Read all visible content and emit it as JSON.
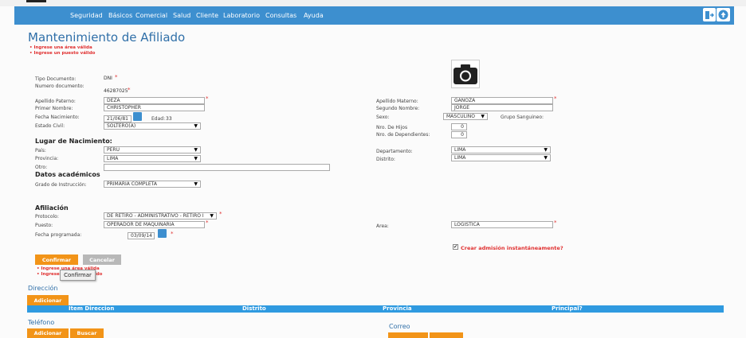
{
  "nav": {
    "menu": [
      "Seguridad",
      "Básicos",
      "Comercial",
      "Salud",
      "Cliente",
      "Laboratorio",
      "Consultas",
      "Ayuda"
    ]
  },
  "page": {
    "title": "Mantenimiento de Afiliado",
    "errors": [
      "Ingrese una área válida",
      "Ingrese un puesto válido"
    ]
  },
  "form": {
    "tipo_doc_label": "Tipo Documento:",
    "tipo_doc_value": "DNI",
    "num_doc_label": "Numero documento:",
    "num_doc_value": "46287025",
    "ap_paterno_label": "Apellido Paterno:",
    "ap_paterno_value": "DEZA",
    "primer_nombre_label": "Primer Nombre:",
    "primer_nombre_value": "CHRISTOPHER",
    "fecha_nac_label": "Fecha Nacimiento:",
    "fecha_nac_value": "21/06/81",
    "edad_label": "Edad:",
    "edad_value": "33",
    "estado_civil_label": "Estado Civil:",
    "estado_civil_value": "SOLTERO(A)",
    "ap_materno_label": "Apellido Materno:",
    "ap_materno_value": "GANOZA",
    "segundo_nombre_label": "Segundo Nombre:",
    "segundo_nombre_value": "JORGE",
    "sexo_label": "Sexo:",
    "sexo_value": "MASCULINO",
    "grupo_label": "Grupo Sanguineo:",
    "hijos_label": "Nro. De Hijos",
    "hijos_value": "0",
    "dependientes_label": "Nro. de Dependientes:",
    "dependientes_value": "0",
    "lugar_title": "Lugar de Nacimiento:",
    "pais_label": "País:",
    "pais_value": "PERU",
    "provincia_label": "Provincia:",
    "provincia_value": "LIMA",
    "otro_label": "Otro:",
    "departamento_label": "Departamento:",
    "departamento_value": "LIMA",
    "distrito_label": "Distrito:",
    "distrito_value": "LIMA",
    "academicos_title": "Datos académicos",
    "grado_label": "Grado de Instrucción:",
    "grado_value": "PRIMARIA COMPLETA",
    "afiliacion_title": "Afiliación",
    "protocolo_label": "Protocolo:",
    "protocolo_value": "DE RETIRO - ADMINISTRATIVO - RETIRO I",
    "puesto_label": "Puesto:",
    "puesto_value": "OPERADOR DE MAQUINARIA",
    "fecha_prog_label": "Fecha programada:",
    "fecha_prog_value": "03/09/14",
    "area_label": "Area:",
    "area_value": "LOGISTICA",
    "crear_admision": "Crear admisión instantáneamente?",
    "required_mark": "*"
  },
  "buttons": {
    "confirmar": "Confirmar",
    "cancelar": "Cancelar",
    "tooltip": "Confirmar",
    "adicionar": "Adicionar",
    "buscar": "Buscar"
  },
  "bottom_errors": [
    "Ingrese una área válida",
    "Ingrese un puesto válido"
  ],
  "direccion": {
    "title": "Dirección",
    "columns": [
      "Item Direccion",
      "Distrito",
      "Provincia",
      "Principal?"
    ]
  },
  "telefono": {
    "title": "Teléfono"
  },
  "correo": {
    "title": "Correo"
  },
  "colors": {
    "nav": "#3d8fcf",
    "title": "#2f6fa8",
    "button": "#f29418",
    "error": "#e03030",
    "header": "#2f9ae0"
  }
}
